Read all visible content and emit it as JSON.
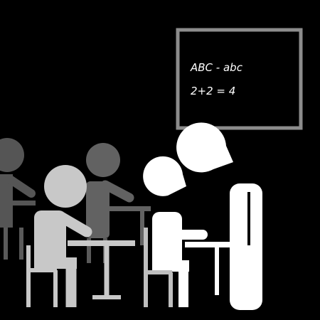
{
  "chalkboard": {
    "line1": "ABC - abc",
    "line2": "2+2 = 4"
  },
  "colors": {
    "background": "#000000",
    "board_frame": "#8c8c8c",
    "chalk_text": "#ffffff",
    "back_row": "#555555",
    "middle_row": "#7a7a7a",
    "front_student": "#c8c8c8",
    "near_student": "#ffffff",
    "teacher": "#ffffff"
  }
}
